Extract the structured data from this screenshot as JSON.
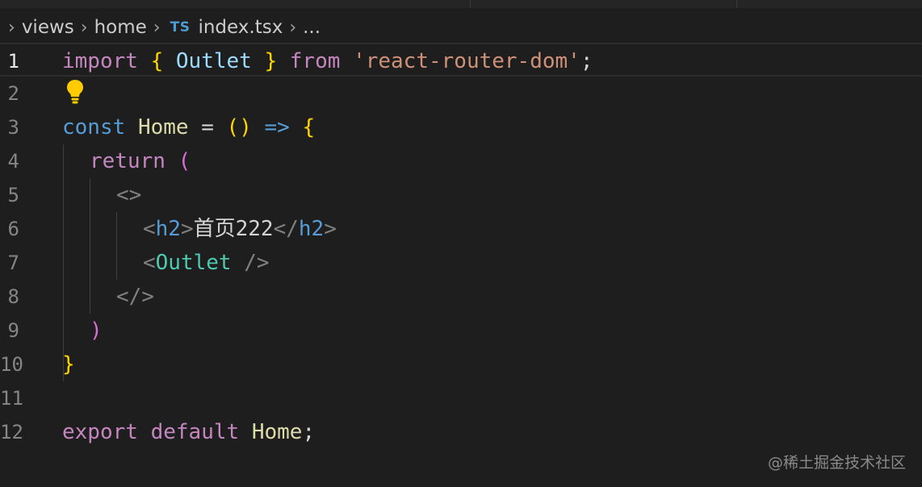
{
  "breadcrumb": {
    "items": [
      "views",
      "home"
    ],
    "file_icon": "TS",
    "file_name": "index.tsx",
    "ellipsis": "..."
  },
  "editor": {
    "active_line": 1,
    "lines": [
      {
        "number": "1",
        "tokens": [
          "import",
          " ",
          "{",
          " ",
          "Outlet",
          " ",
          "}",
          " ",
          "from",
          " ",
          "'react-router-dom'",
          ";"
        ]
      },
      {
        "number": "2",
        "tokens": []
      },
      {
        "number": "3",
        "tokens": [
          "const",
          " ",
          "Home",
          " = ",
          "(",
          ")",
          " ",
          "=>",
          " ",
          "{"
        ]
      },
      {
        "number": "4",
        "tokens": [
          "return",
          " ",
          "("
        ]
      },
      {
        "number": "5",
        "tokens": [
          "<>"
        ]
      },
      {
        "number": "6",
        "tokens": [
          "<",
          "h2",
          ">",
          "首页222",
          "</",
          "h2",
          ">"
        ]
      },
      {
        "number": "7",
        "tokens": [
          "<",
          "Outlet",
          " />"
        ]
      },
      {
        "number": "8",
        "tokens": [
          "</>"
        ]
      },
      {
        "number": "9",
        "tokens": [
          ")"
        ]
      },
      {
        "number": "10",
        "tokens": [
          "}"
        ]
      },
      {
        "number": "11",
        "tokens": []
      },
      {
        "number": "12",
        "tokens": [
          "export",
          " ",
          "default",
          " ",
          "Home",
          ";"
        ]
      }
    ],
    "lightbulb_icon": "lightbulb-icon"
  },
  "watermark": "@稀土掘金技术社区",
  "colors": {
    "background": "#1e1e1e",
    "keyword_purple": "#c586c0",
    "keyword_blue": "#569cd6",
    "brace": "#ffd700",
    "string": "#ce9178",
    "component": "#4ec9b0",
    "paren": "#da70d6",
    "lightbulb": "#ffcc00"
  }
}
